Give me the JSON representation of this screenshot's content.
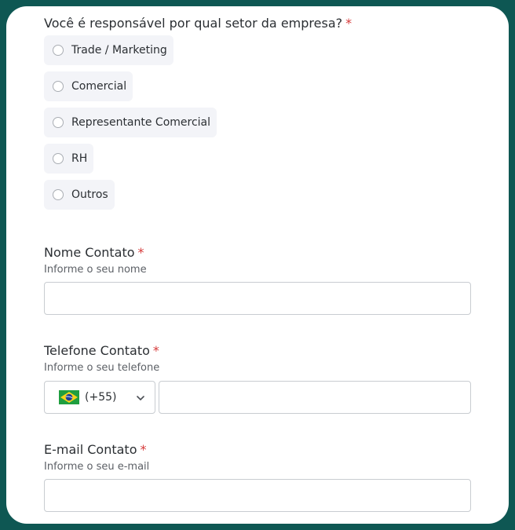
{
  "sector_question": {
    "label": "Você é responsável por qual setor da empresa?",
    "required_mark": "*",
    "options": [
      {
        "label": "Trade / Marketing",
        "selected": false
      },
      {
        "label": "Comercial",
        "selected": false
      },
      {
        "label": "Representante Comercial",
        "selected": false
      },
      {
        "label": "RH",
        "selected": false
      },
      {
        "label": "Outros",
        "selected": false
      }
    ]
  },
  "contact_name": {
    "label": "Nome Contato",
    "required_mark": "*",
    "help": "Informe o seu nome",
    "value": ""
  },
  "contact_phone": {
    "label": "Telefone Contato",
    "required_mark": "*",
    "help": "Informe o seu telefone",
    "country_flag": "brazil-flag-icon",
    "country_code": "(+55)",
    "value": ""
  },
  "contact_email": {
    "label": "E-mail Contato",
    "required_mark": "*",
    "help": "Informe o seu e-mail",
    "value": ""
  },
  "colors": {
    "frame": "#0e5753",
    "required": "#d63a3a",
    "option_bg": "#f3f4f8"
  }
}
